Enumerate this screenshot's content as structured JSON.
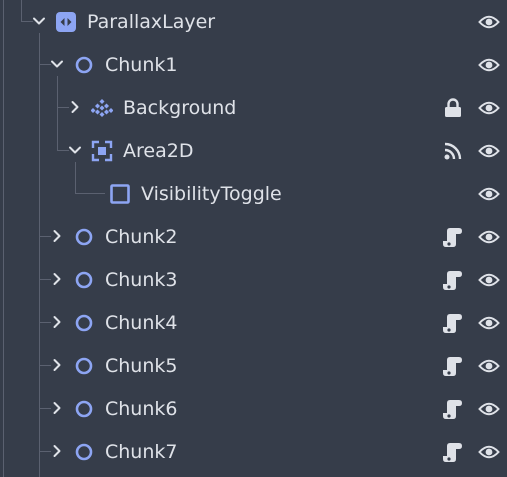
{
  "colors": {
    "background": "#363d4a",
    "text": "#dfe2e8",
    "node_icon": "#8da5f3",
    "indicator": "#dfe2e8",
    "guide": "#5b6170"
  },
  "tree": {
    "parallax_layer": {
      "label": "ParallaxLayer",
      "expanded": true,
      "icon": "parallax-layer-icon"
    },
    "chunk1": {
      "label": "Chunk1",
      "expanded": true,
      "icon": "node2d-icon"
    },
    "background": {
      "label": "Background",
      "expanded": false,
      "icon": "tilemap-icon",
      "locked": true
    },
    "area2d": {
      "label": "Area2D",
      "expanded": true,
      "icon": "area2d-icon",
      "signals_connected": true
    },
    "visibility_toggle": {
      "label": "VisibilityToggle",
      "icon": "control-icon"
    },
    "chunk2": {
      "label": "Chunk2",
      "expanded": false,
      "icon": "node2d-icon",
      "has_script": true
    },
    "chunk3": {
      "label": "Chunk3",
      "expanded": false,
      "icon": "node2d-icon",
      "has_script": true
    },
    "chunk4": {
      "label": "Chunk4",
      "expanded": false,
      "icon": "node2d-icon",
      "has_script": true
    },
    "chunk5": {
      "label": "Chunk5",
      "expanded": false,
      "icon": "node2d-icon",
      "has_script": true
    },
    "chunk6": {
      "label": "Chunk6",
      "expanded": false,
      "icon": "node2d-icon",
      "has_script": true
    },
    "chunk7": {
      "label": "Chunk7",
      "expanded": false,
      "icon": "node2d-icon",
      "has_script": true
    }
  }
}
